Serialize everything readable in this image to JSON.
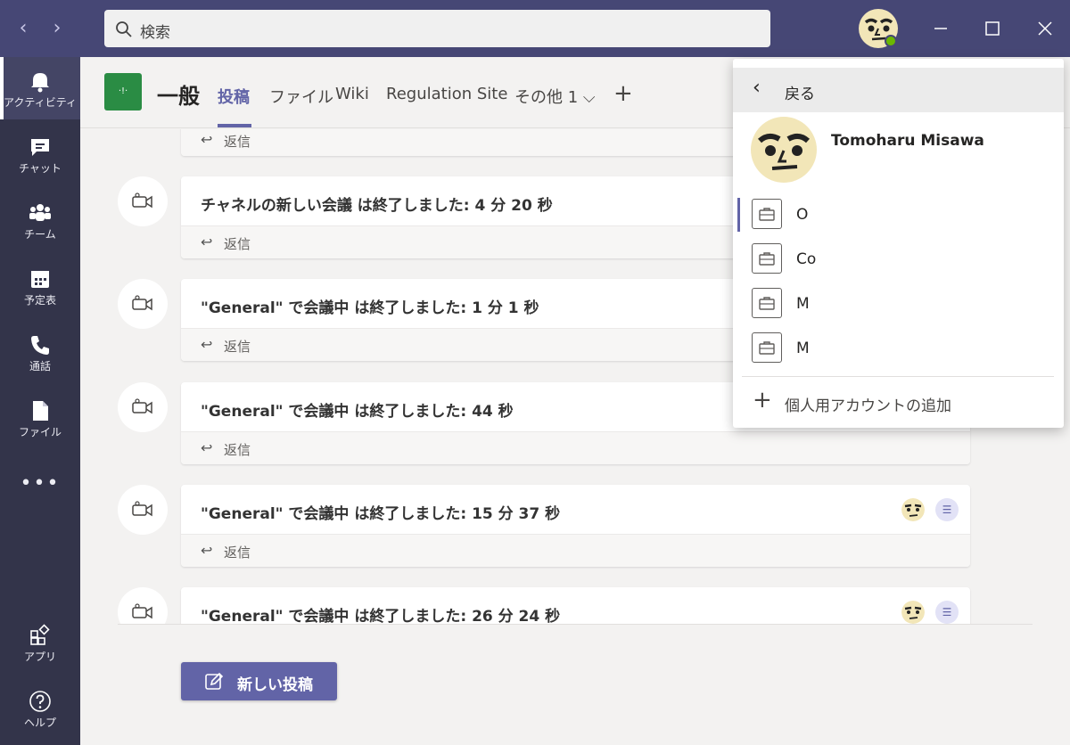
{
  "titlebar": {
    "back_icon": "‹",
    "forward_icon": "›",
    "search_placeholder": "検索"
  },
  "rail": {
    "items": [
      {
        "label": "アクティビティ",
        "icon": "bell-icon",
        "active": true
      },
      {
        "label": "チャット",
        "icon": "chat-icon"
      },
      {
        "label": "チーム",
        "icon": "teams-icon"
      },
      {
        "label": "予定表",
        "icon": "calendar-icon"
      },
      {
        "label": "通話",
        "icon": "phone-icon"
      },
      {
        "label": "ファイル",
        "icon": "file-icon"
      },
      {
        "label": "•••",
        "icon": "more-icon"
      },
      {
        "label": "アプリ",
        "icon": "apps-icon"
      },
      {
        "label": "ヘルプ",
        "icon": "help-icon"
      }
    ]
  },
  "header": {
    "team_tile_text": "·!·",
    "channel_name": "一般",
    "tabs": [
      "投稿",
      "ファイル",
      "Wiki",
      "Regulation Site",
      "その他 1 ⌵"
    ],
    "add_tab": "+"
  },
  "feed": {
    "reply_label": "返信",
    "reply_arrow": "↩",
    "messages": [
      {
        "title": "チャネルの新しい会議 は終了しました: 4 分 20 秒"
      },
      {
        "title": "\"General\" で会議中 は終了しました: 1 分 1 秒"
      },
      {
        "title": "\"General\" で会議中 は終了しました: 44 秒"
      },
      {
        "title": "\"General\" で会議中 は終了しました: 15 分 37 秒"
      },
      {
        "title": "\"General\" で会議中 は終了しました: 26 分 24 秒"
      }
    ],
    "transcript_glyph": "☰"
  },
  "new_post": {
    "label": "新しい投稿"
  },
  "account_menu": {
    "back_label": "戻る",
    "back_icon": "‹",
    "user_name": "Tomoharu Misawa",
    "orgs": [
      "O",
      "Co",
      "M",
      "M"
    ],
    "add_icon": "+",
    "add_account_label": "個人用アカウントの追加"
  }
}
